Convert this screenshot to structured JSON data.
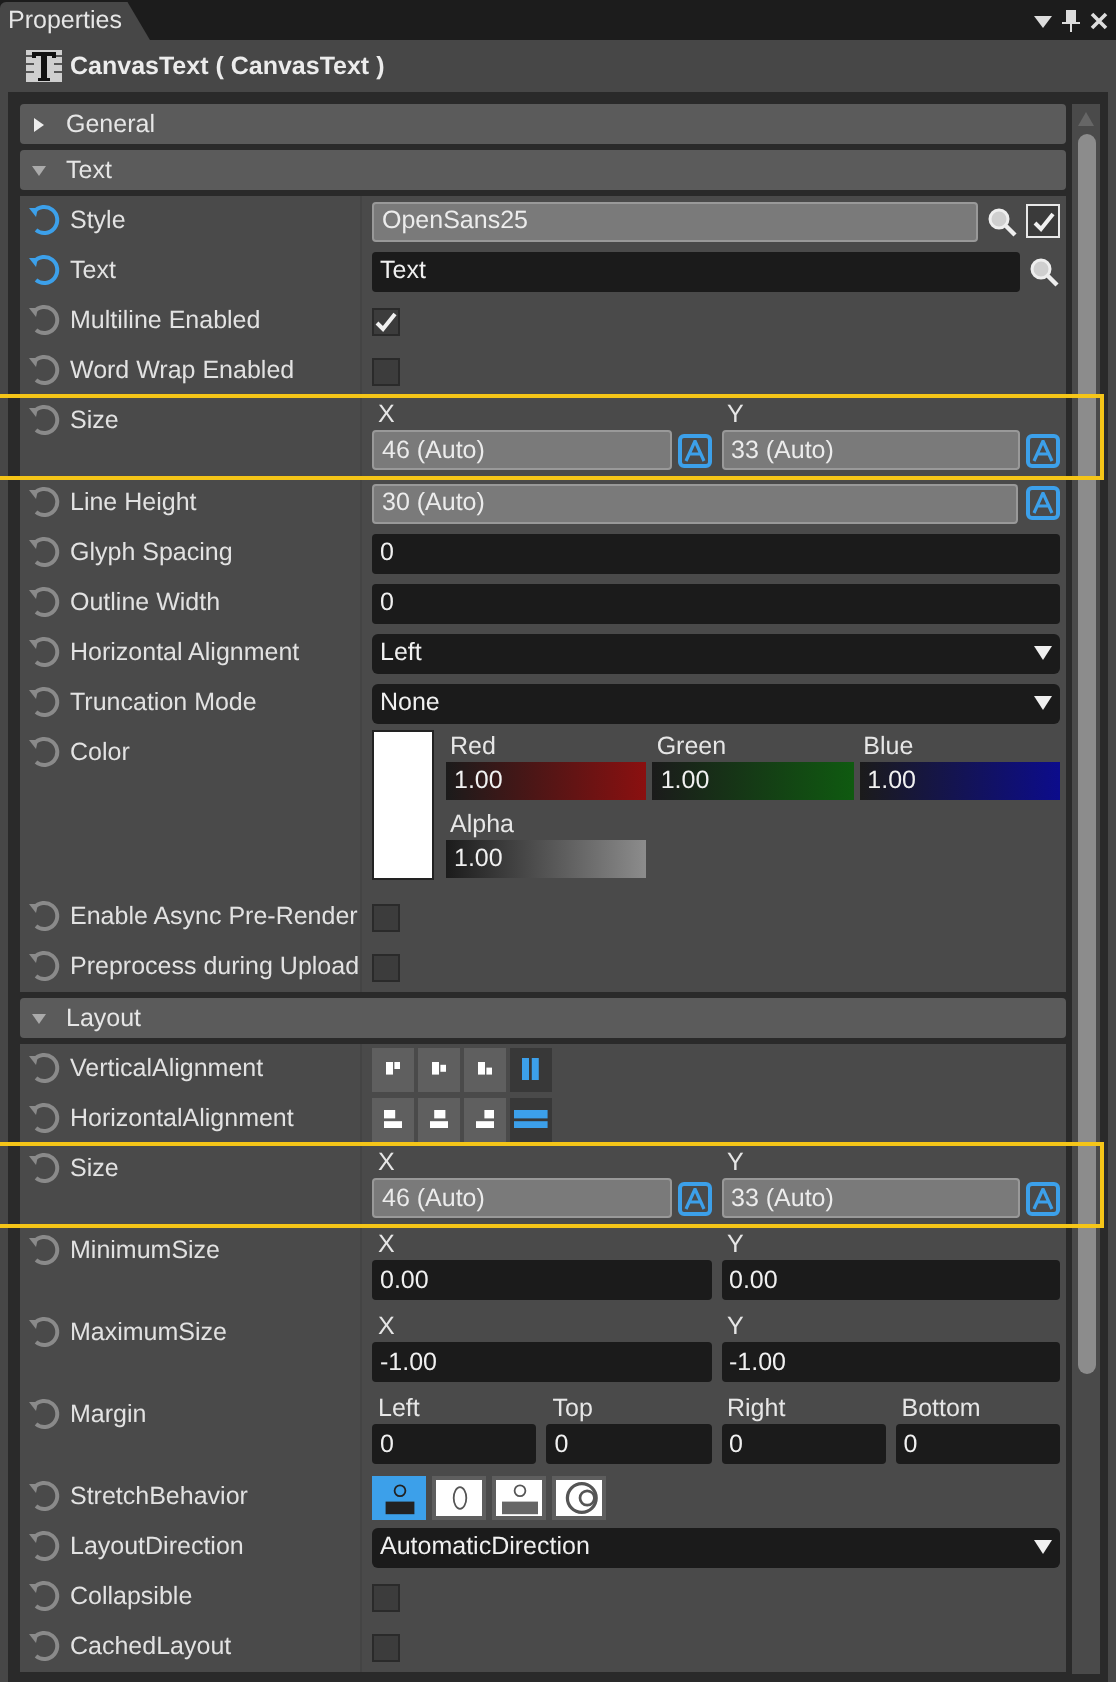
{
  "panel": {
    "tab": "Properties",
    "title": "CanvasText ( CanvasText )"
  },
  "sections": [
    {
      "title": "General",
      "expanded": false
    },
    {
      "title": "Text",
      "expanded": true,
      "rows": [
        {
          "kind": "text",
          "label": "Style",
          "modified": true,
          "highlighted": false,
          "value": "OpenSans25",
          "readonly": true,
          "find": true,
          "checked": true
        },
        {
          "kind": "text",
          "label": "Text",
          "modified": true,
          "highlighted": false,
          "value": "Text",
          "readonly": false,
          "find": true
        },
        {
          "kind": "checkbox",
          "label": "Multiline Enabled",
          "modified": false,
          "highlighted": false,
          "checked": true
        },
        {
          "kind": "checkbox",
          "label": "Word Wrap Enabled",
          "modified": false,
          "highlighted": false,
          "checked": false
        },
        {
          "kind": "fields",
          "label": "Size",
          "modified": false,
          "highlighted": true,
          "fields": [
            {
              "label": "X",
              "value": "46 (Auto)",
              "readonly": true,
              "auto": true
            },
            {
              "label": "Y",
              "value": "33 (Auto)",
              "readonly": true,
              "auto": true
            }
          ]
        },
        {
          "kind": "text",
          "label": "Line Height",
          "modified": false,
          "highlighted": false,
          "value": "30 (Auto)",
          "readonly": true,
          "auto": true
        },
        {
          "kind": "text",
          "label": "Glyph Spacing",
          "modified": false,
          "highlighted": false,
          "value": "0",
          "readonly": false
        },
        {
          "kind": "text",
          "label": "Outline Width",
          "modified": false,
          "highlighted": false,
          "value": "0",
          "readonly": false
        },
        {
          "kind": "dropdown",
          "label": "Horizontal Alignment",
          "modified": false,
          "highlighted": false,
          "value": "Left"
        },
        {
          "kind": "dropdown",
          "label": "Truncation Mode",
          "modified": false,
          "highlighted": false,
          "value": "None"
        },
        {
          "kind": "color",
          "label": "Color",
          "modified": false,
          "highlighted": false,
          "channels": [
            {
              "label": "Red",
              "value": "1.00",
              "color": "#8b1010"
            },
            {
              "label": "Green",
              "value": "1.00",
              "color": "#0f5a10"
            },
            {
              "label": "Blue",
              "value": "1.00",
              "color": "#0c0c8c"
            },
            {
              "label": "Alpha",
              "value": "1.00",
              "color": "#8c8c8c"
            }
          ]
        },
        {
          "kind": "checkbox",
          "label": "Enable Async Pre-Render",
          "modified": false,
          "highlighted": false,
          "checked": false
        },
        {
          "kind": "checkbox",
          "label": "Preprocess during Upload",
          "modified": false,
          "highlighted": false,
          "checked": false
        }
      ]
    },
    {
      "title": "Layout",
      "expanded": true,
      "rows": [
        {
          "kind": "valign",
          "label": "VerticalAlignment",
          "modified": false,
          "highlighted": false,
          "options": [
            {
              "selected": false
            },
            {
              "selected": false
            },
            {
              "selected": false
            },
            {
              "selected": true
            }
          ]
        },
        {
          "kind": "halign",
          "label": "HorizontalAlignment",
          "modified": false,
          "highlighted": false,
          "options": [
            {
              "selected": false
            },
            {
              "selected": false
            },
            {
              "selected": false
            },
            {
              "selected": true
            }
          ]
        },
        {
          "kind": "fields",
          "label": "Size",
          "modified": false,
          "highlighted": true,
          "fields": [
            {
              "label": "X",
              "value": "46 (Auto)",
              "readonly": true,
              "auto": true
            },
            {
              "label": "Y",
              "value": "33 (Auto)",
              "readonly": true,
              "auto": true
            }
          ]
        },
        {
          "kind": "fields",
          "label": "MinimumSize",
          "modified": false,
          "highlighted": false,
          "fields": [
            {
              "label": "X",
              "value": "0.00",
              "readonly": false,
              "auto": false
            },
            {
              "label": "Y",
              "value": "0.00",
              "readonly": false,
              "auto": false
            }
          ]
        },
        {
          "kind": "fields",
          "label": "MaximumSize",
          "modified": false,
          "highlighted": false,
          "fields": [
            {
              "label": "X",
              "value": "-1.00",
              "readonly": false,
              "auto": false
            },
            {
              "label": "Y",
              "value": "-1.00",
              "readonly": false,
              "auto": false
            }
          ]
        },
        {
          "kind": "fields",
          "label": "Margin",
          "modified": false,
          "highlighted": false,
          "fields": [
            {
              "label": "Left",
              "value": "0",
              "readonly": false,
              "auto": false
            },
            {
              "label": "Top",
              "value": "0",
              "readonly": false,
              "auto": false
            },
            {
              "label": "Right",
              "value": "0",
              "readonly": false,
              "auto": false
            },
            {
              "label": "Bottom",
              "value": "0",
              "readonly": false,
              "auto": false
            }
          ]
        },
        {
          "kind": "stretch",
          "label": "StretchBehavior",
          "modified": false,
          "highlighted": false,
          "options": [
            {
              "selected": true
            },
            {
              "selected": false
            },
            {
              "selected": false
            },
            {
              "selected": false
            }
          ]
        },
        {
          "kind": "dropdown",
          "label": "LayoutDirection",
          "modified": false,
          "highlighted": false,
          "value": "AutomaticDirection"
        },
        {
          "kind": "checkbox",
          "label": "Collapsible",
          "modified": false,
          "highlighted": false,
          "checked": false
        },
        {
          "kind": "checkbox",
          "label": "CachedLayout",
          "modified": false,
          "highlighted": false,
          "checked": false
        }
      ]
    }
  ]
}
